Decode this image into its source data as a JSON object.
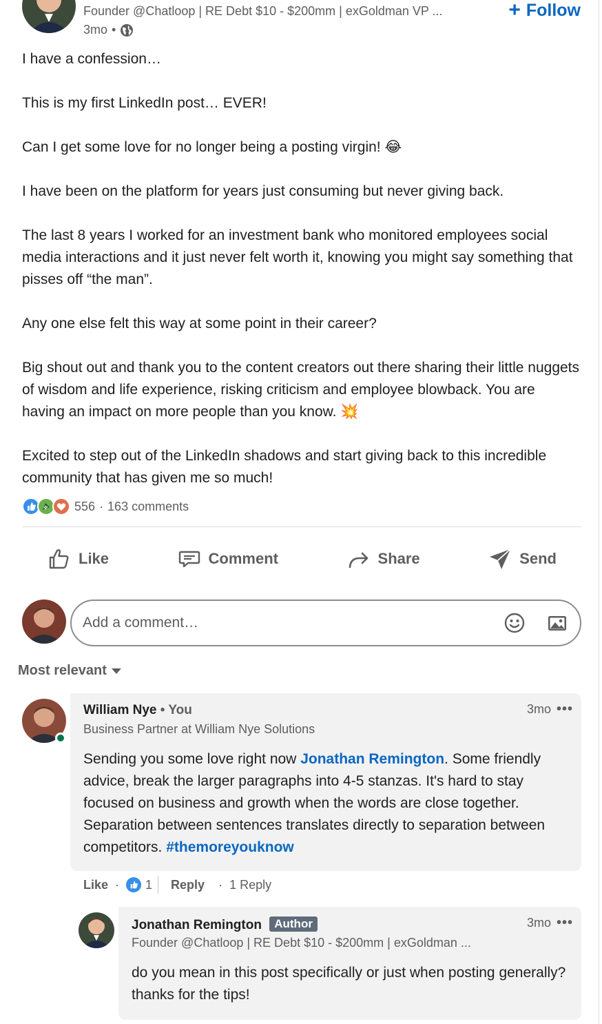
{
  "post": {
    "author_headline": "Founder @Chatloop | RE Debt $10 - $200mm | exGoldman VP ...",
    "time": "3mo",
    "follow_label": "Follow",
    "paragraphs": [
      "I have a confession…",
      "This is my first LinkedIn post… EVER!",
      "Can I get some love for no longer being a posting virgin! 😂",
      "I have been on the platform for years just consuming but never giving back.",
      "The last 8 years I worked for an investment bank who monitored employees social media interactions and it just never felt worth it, knowing you might say something that pisses off “the man”.",
      "Any one else felt this way at some point in their career?",
      "Big shout out and thank you to the content creators out there sharing their little nuggets of wisdom and life experience, risking criticism and employee blowback. You are having an impact on more people than you know. 💥",
      "Excited to step out of the LinkedIn shadows and start giving back to this incredible community that has given me so much!"
    ],
    "reaction_icons": [
      "like-icon",
      "celebrate-icon",
      "love-icon"
    ],
    "reaction_count": "556",
    "comments_count": "163 comments"
  },
  "actions": {
    "like": "Like",
    "comment": "Comment",
    "share": "Share",
    "send": "Send"
  },
  "comment_input": {
    "placeholder": "Add a comment…"
  },
  "sort": {
    "label": "Most relevant"
  },
  "comments": [
    {
      "name": "William Nye",
      "you_label": "• You",
      "headline": "Business Partner at William Nye Solutions",
      "time": "3mo",
      "text_before": "Sending you some love right now ",
      "mention": "Jonathan Remington",
      "text_after": ". Some friendly advice, break the larger paragraphs into 4-5 stanzas. It's hard to stay focused on business and growth when the words are close together. Separation between sentences translates directly to separation between competitors. ",
      "hashtag": "#themoreyouknow",
      "like_label": "Like",
      "like_count": "1",
      "reply_label": "Reply",
      "replies_label": "1 Reply"
    }
  ],
  "reply": {
    "name": "Jonathan Remington",
    "badge": "Author",
    "headline": "Founder @Chatloop | RE Debt $10 - $200mm | exGoldman ...",
    "time": "3mo",
    "text": "do you mean in this post specifically or just when posting generally? thanks for the tips!"
  },
  "colors": {
    "link": "#0a66c2",
    "muted": "#5e5e5e",
    "bubble": "#f2f2f2",
    "online": "#01754f"
  }
}
